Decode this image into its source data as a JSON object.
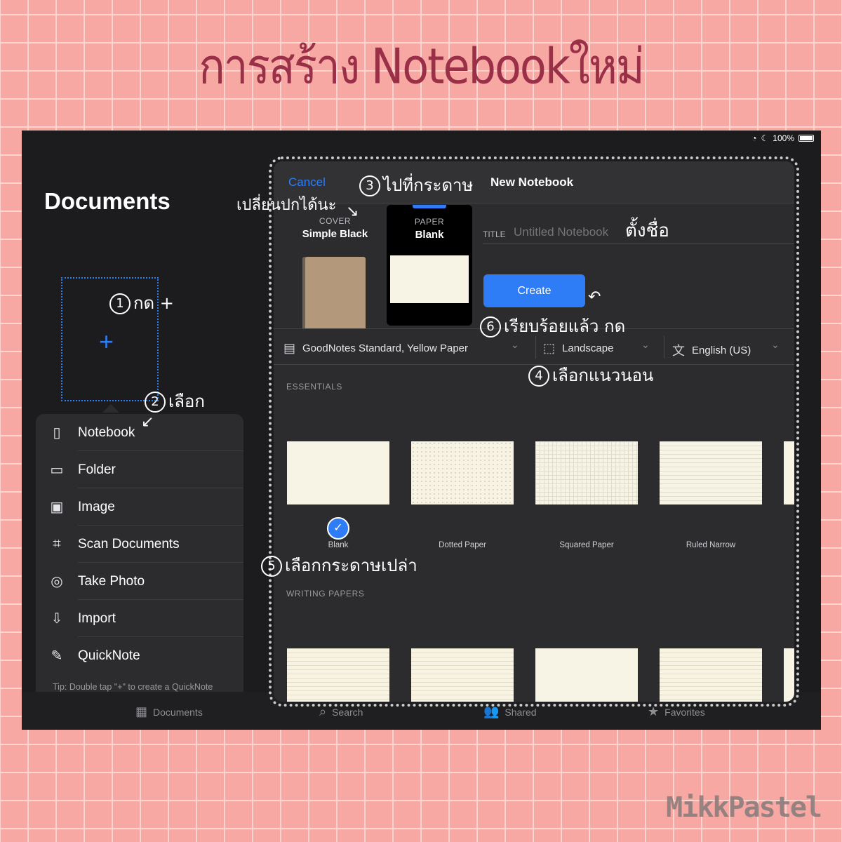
{
  "banner": {
    "title": "การสร้าง Notebookใหม่"
  },
  "watermark": "MikkPastel",
  "status": {
    "battery": "100%",
    "wifi_icon": "wifi-icon",
    "moon_icon": "moon-icon"
  },
  "documents": {
    "title": "Documents",
    "new_plus": "+"
  },
  "menu": {
    "items": [
      {
        "label": "Notebook",
        "icon": "▯"
      },
      {
        "label": "Folder",
        "icon": "▭"
      },
      {
        "label": "Image",
        "icon": "▣"
      },
      {
        "label": "Scan Documents",
        "icon": "⌗"
      },
      {
        "label": "Take Photo",
        "icon": "◎"
      },
      {
        "label": "Import",
        "icon": "⇩"
      },
      {
        "label": "QuickNote",
        "icon": "✎"
      }
    ],
    "tip": "Tip: Double tap \"+\" to create a QuickNote"
  },
  "tabbar": {
    "items": [
      {
        "label": "Documents",
        "icon": "▦"
      },
      {
        "label": "Search",
        "icon": "⌕"
      },
      {
        "label": "Shared",
        "icon": "👥"
      },
      {
        "label": "Favorites",
        "icon": "★"
      }
    ]
  },
  "modal": {
    "cancel": "Cancel",
    "title": "New Notebook",
    "cover": {
      "caption": "COVER",
      "name": "Simple Black"
    },
    "paper": {
      "caption": "PAPER",
      "name": "Blank"
    },
    "title_label": "TITLE",
    "title_placeholder": "Untitled Notebook",
    "create": "Create",
    "options": {
      "template": "GoodNotes Standard, Yellow Paper",
      "orientation": "Landscape",
      "language": "English (US)"
    },
    "sections": {
      "essentials": "ESSENTIALS",
      "writing": "WRITING PAPERS"
    },
    "essentials": [
      {
        "label": "Blank",
        "style": "blank",
        "selected": true
      },
      {
        "label": "Dotted Paper",
        "style": "dots",
        "selected": false
      },
      {
        "label": "Squared Paper",
        "style": "grid",
        "selected": false
      },
      {
        "label": "Ruled Narrow",
        "style": "ruled",
        "selected": false
      }
    ],
    "check": "✓"
  },
  "annotations": {
    "step1": {
      "num": "1",
      "text": "กด +"
    },
    "step2": {
      "num": "2",
      "text": "เลือก"
    },
    "step3": {
      "num": "3",
      "text": "ไปที่กระดาษ"
    },
    "step4": {
      "num": "4",
      "text": "เลือกแนวนอน"
    },
    "step5": {
      "num": "5",
      "text": "เลือกกระดาษเปล่า"
    },
    "step6": {
      "num": "6",
      "text": "เรียบร้อยแล้ว กด"
    },
    "cover_note": "เปลี่ยนปกได้นะ",
    "title_note": "ตั้งชื่อ"
  },
  "colors": {
    "accent": "#2e7cf6",
    "banner": "#9a2f48",
    "background": "#f7a8a3"
  }
}
